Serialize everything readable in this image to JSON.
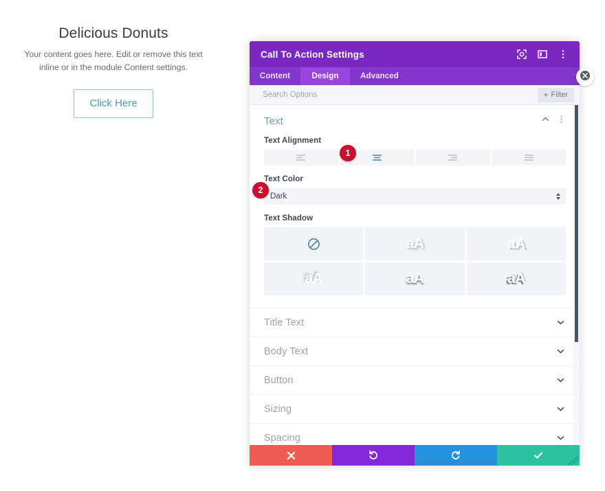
{
  "preview": {
    "title": "Delicious Donuts",
    "body": "Your content goes here. Edit or remove this text inline or in the module Content settings.",
    "button_label": "Click Here"
  },
  "modal": {
    "title": "Call To Action Settings",
    "header_icons": [
      {
        "name": "focus-target-icon"
      },
      {
        "name": "panel-layout-icon"
      },
      {
        "name": "more-vertical-icon"
      }
    ],
    "tabs": [
      {
        "label": "Content",
        "active": false
      },
      {
        "label": "Design",
        "active": true
      },
      {
        "label": "Advanced",
        "active": false
      }
    ],
    "search": {
      "placeholder": "Search Options",
      "value": "",
      "filter_label": "Filter",
      "filter_plus": "+"
    },
    "open_section": {
      "title": "Text",
      "collapse_icon": "chevron-up-icon",
      "menu_icon": "more-vertical-icon",
      "fields": [
        {
          "label": "Text Alignment",
          "type": "button-group",
          "options": [
            {
              "name": "align-left",
              "selected": false
            },
            {
              "name": "align-center",
              "selected": true
            },
            {
              "name": "align-right",
              "selected": false
            },
            {
              "name": "align-justify",
              "selected": false
            }
          ]
        },
        {
          "label": "Text Color",
          "type": "select",
          "value": "Dark"
        },
        {
          "label": "Text Shadow",
          "type": "shadow-grid",
          "options": [
            {
              "name": "no-shadow",
              "glyph": "",
              "selected": true
            },
            {
              "name": "shadow-bottom-right",
              "glyph": "aA",
              "selected": false
            },
            {
              "name": "shadow-hard-offset",
              "glyph": "aA",
              "selected": false
            },
            {
              "name": "shadow-top-left",
              "glyph": "aA",
              "selected": false
            },
            {
              "name": "shadow-drop-down",
              "glyph": "aA",
              "selected": false
            },
            {
              "name": "shadow-double",
              "glyph": "aA",
              "selected": false
            }
          ]
        }
      ]
    },
    "collapsed_sections": [
      {
        "label": "Title Text"
      },
      {
        "label": "Body Text"
      },
      {
        "label": "Button"
      },
      {
        "label": "Sizing"
      },
      {
        "label": "Spacing"
      }
    ],
    "footer_buttons": [
      {
        "name": "cancel-button",
        "icon": "close-x-icon",
        "color": "#ef5c52"
      },
      {
        "name": "undo-button",
        "icon": "undo-icon",
        "color": "#8228d9"
      },
      {
        "name": "redo-button",
        "icon": "redo-icon",
        "color": "#2591dd"
      },
      {
        "name": "save-button",
        "icon": "check-icon",
        "color": "#2ec2a0"
      }
    ]
  },
  "callouts": [
    {
      "number": "1"
    },
    {
      "number": "2"
    }
  ],
  "colors": {
    "header_purple": "#7b27c1",
    "tabs_purple": "#8236cc",
    "tab_active_purple": "#9944dd",
    "callout_red": "#c8102e",
    "section_title_blue": "#6e9cb5",
    "cta_accent": "#4c9cb0"
  }
}
